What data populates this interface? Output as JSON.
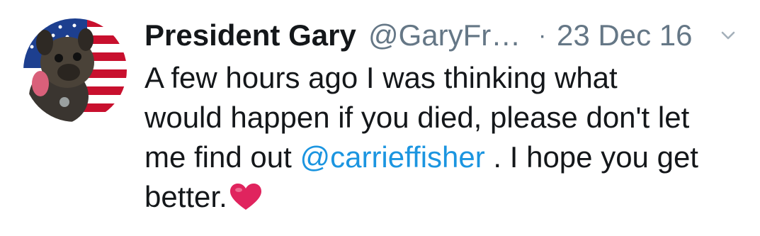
{
  "tweet": {
    "display_name": "President Gary",
    "handle": "@GaryFr…",
    "dot": "·",
    "timestamp": "23 Dec 16",
    "text": {
      "line1": "A few hours ago I was thinking what",
      "line2": "would happen if you died, please don't let",
      "line3_pre": "me find out ",
      "mention": "@carrieffisher",
      "line3_post": " . I hope you get",
      "line4": "better."
    },
    "heart_emoji": "red-heart-icon"
  },
  "colors": {
    "name": "#14171a",
    "secondary": "#657786",
    "mention": "#1b95e0",
    "heart": "#e0245e"
  }
}
